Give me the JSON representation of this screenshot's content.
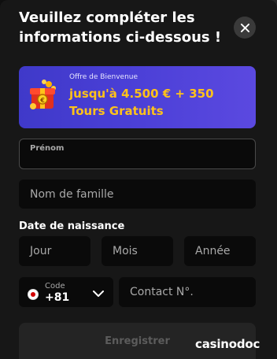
{
  "modal": {
    "title": "Veuillez compléter les informations ci-dessous !",
    "close_icon": "close-icon"
  },
  "promo": {
    "kicker": "Offre de Bienvenue",
    "headline": "jusqu'à 4.500 € + 350 Tours Gratuits",
    "icon": "gift-chest-icon",
    "bg_color": "#4a3fd6",
    "accent_color": "#ffc21a"
  },
  "form": {
    "first_name_label": "Prénom",
    "last_name_placeholder": "Nom de famille",
    "dob_label": "Date de naissance",
    "day_placeholder": "Jour",
    "month_placeholder": "Mois",
    "year_placeholder": "Année",
    "phone_code_label": "Code",
    "phone_code_value": "+81",
    "phone_flag": "japan-flag-icon",
    "phone_placeholder": "Contact N°.",
    "submit_label": "Enregistrer"
  },
  "watermark": {
    "text": "casinodoc"
  }
}
